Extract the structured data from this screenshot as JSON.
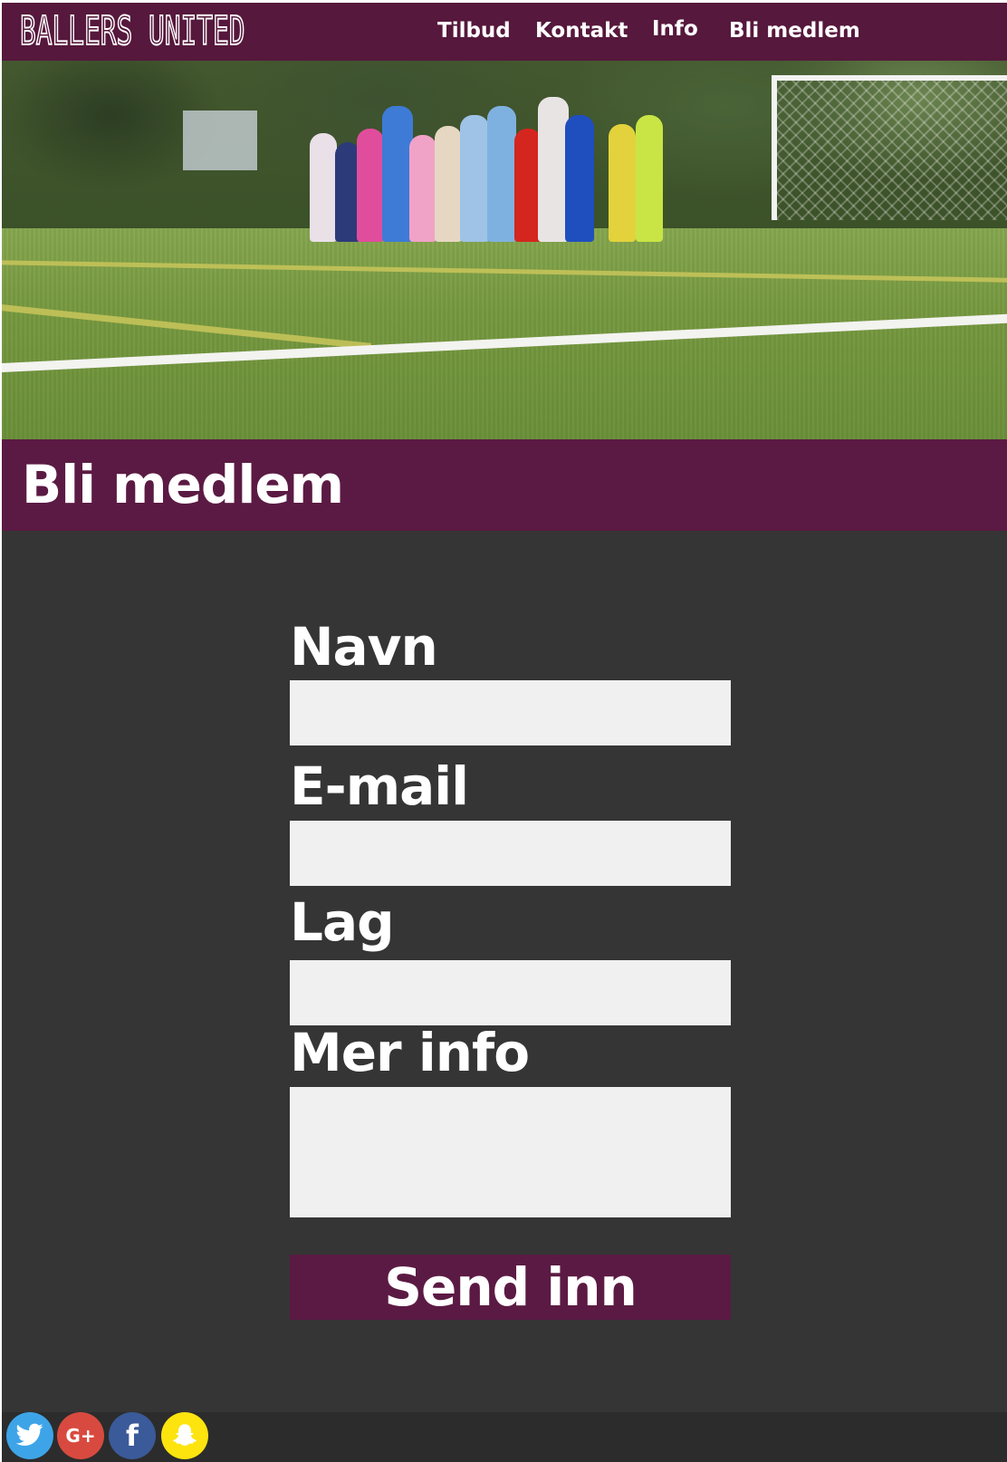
{
  "header": {
    "logo_text": "BALLERS UNITED",
    "nav": {
      "tilbud": "Tilbud",
      "kontakt": "Kontakt",
      "info": "Info",
      "bli_medlem": "Bli medlem"
    }
  },
  "banner": {
    "title": "Bli medlem"
  },
  "form": {
    "name_label": "Navn",
    "email_label": "E-mail",
    "team_label": "Lag",
    "info_label": "Mer info",
    "name_value": "",
    "email_value": "",
    "team_value": "",
    "info_value": "",
    "submit_label": "Send inn"
  },
  "footer": {
    "social": {
      "twitter_icon": "twitter-icon",
      "google_plus_glyph": "G+",
      "facebook_glyph": "f",
      "snapchat_icon": "snapchat-icon"
    }
  },
  "colors": {
    "brand_purple": "#5b1a43",
    "background": "#353535",
    "input_fill": "#f0f0f0",
    "twitter": "#3ea4e8",
    "google_plus": "#d84a3f",
    "facebook": "#3a5a99",
    "snapchat": "#fde40f"
  }
}
